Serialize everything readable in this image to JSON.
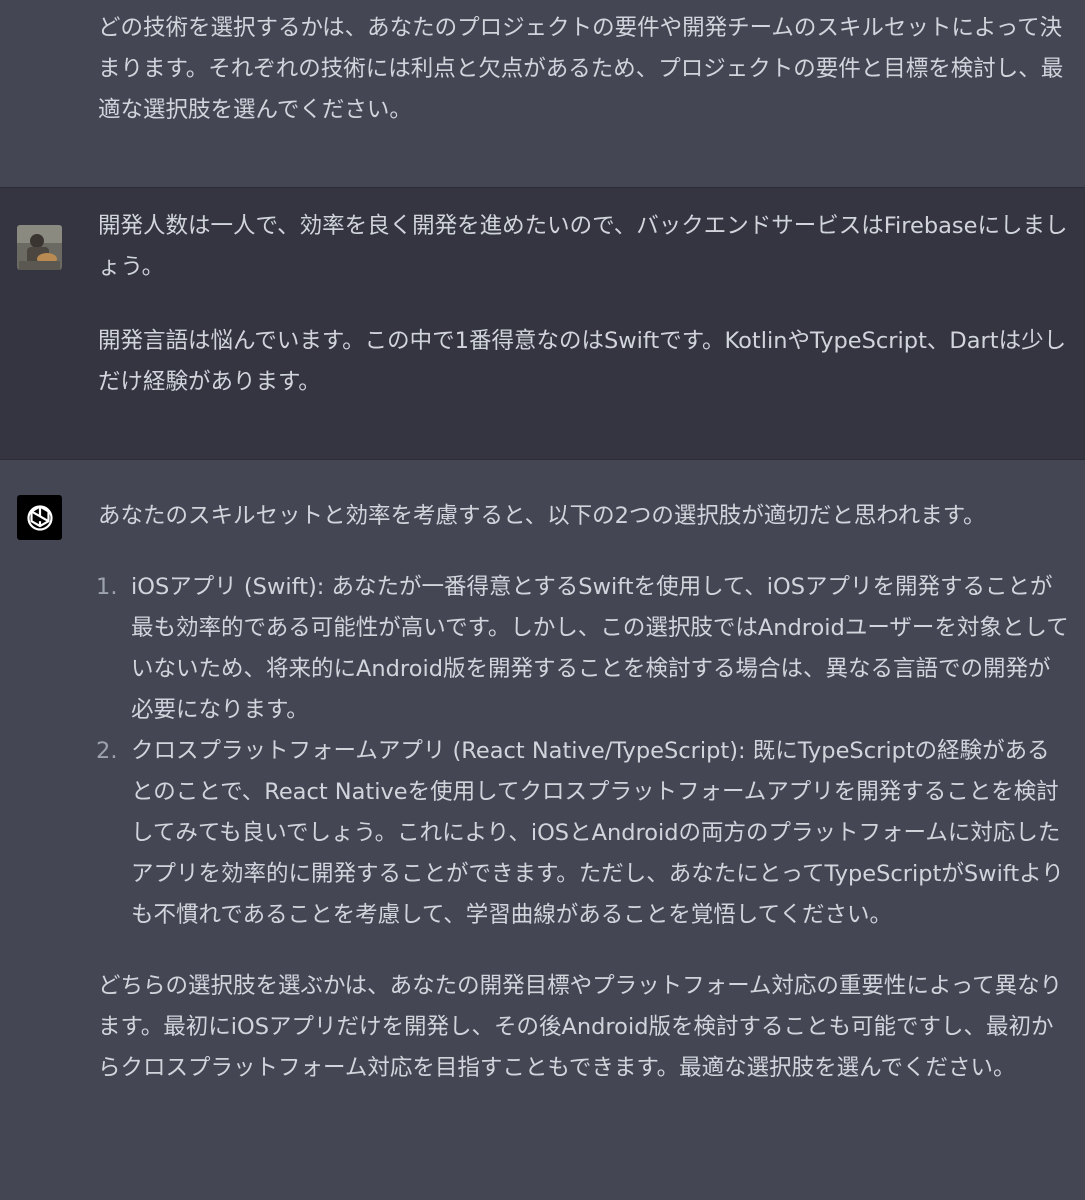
{
  "messages": {
    "first": {
      "text": "どの技術を選択するかは、あなたのプロジェクトの要件や開発チームのスキルセットによって決まります。それぞれの技術には利点と欠点があるため、プロジェクトの要件と目標を検討し、最適な選択肢を選んでください。"
    },
    "user": {
      "p1": "開発人数は一人で、効率を良く開発を進めたいので、バックエンドサービスはFirebaseにしましょう。",
      "p2": "開発言語は悩んでいます。この中で1番得意なのはSwiftです。KotlinやTypeScript、Dartは少しだけ経験があります。"
    },
    "assistant": {
      "intro": "あなたのスキルセットと効率を考慮すると、以下の2つの選択肢が適切だと思われます。",
      "items": [
        {
          "num": "1.",
          "text": "iOSアプリ (Swift): あなたが一番得意とするSwiftを使用して、iOSアプリを開発することが最も効率的である可能性が高いです。しかし、この選択肢ではAndroidユーザーを対象としていないため、将来的にAndroid版を開発することを検討する場合は、異なる言語での開発が必要になります。"
        },
        {
          "num": "2.",
          "text": "クロスプラットフォームアプリ (React Native/TypeScript): 既にTypeScriptの経験があるとのことで、React Nativeを使用してクロスプラットフォームアプリを開発することを検討してみても良いでしょう。これにより、iOSとAndroidの両方のプラットフォームに対応したアプリを効率的に開発することができます。ただし、あなたにとってTypeScriptがSwiftよりも不慣れであることを考慮して、学習曲線があることを覚悟してください。"
        }
      ],
      "outro": "どちらの選択肢を選ぶかは、あなたの開発目標やプラットフォーム対応の重要性によって異なります。最初にiOSアプリだけを開発し、その後Android版を検討することも可能ですし、最初からクロスプラットフォーム対応を目指すこともできます。最適な選択肢を選んでください。"
    }
  },
  "colors": {
    "assistant_bg": "#444654",
    "user_bg": "#343541",
    "text": "#d1d5db",
    "list_number": "#9ca3af"
  },
  "icons": {
    "user_avatar": "user-photo-avatar",
    "assistant_avatar": "openai-logo-icon"
  }
}
